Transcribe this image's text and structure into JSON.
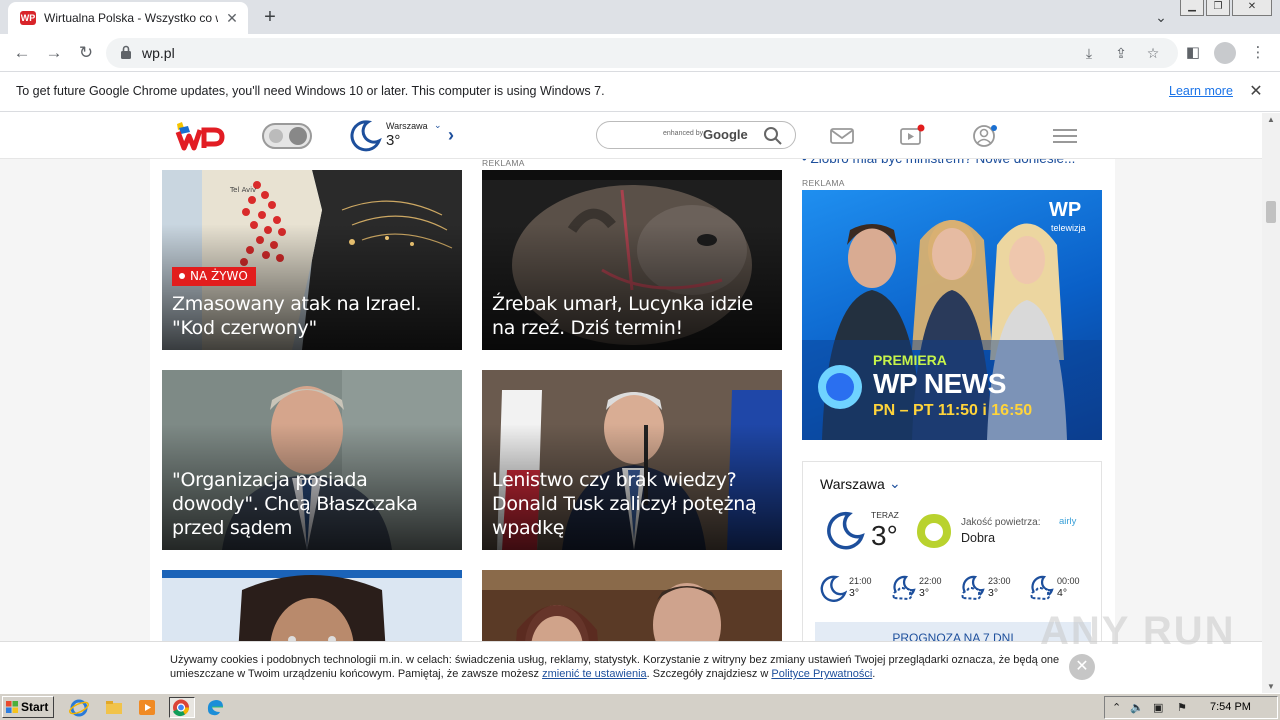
{
  "browser": {
    "tab_title": "Wirtualna Polska - Wszystko co ważne",
    "favicon_text": "WP",
    "url": "wp.pl",
    "infobar_message": "To get future Google Chrome updates, you'll need Windows 10 or later. This computer is using Windows 7.",
    "infobar_link": "Learn more"
  },
  "header": {
    "weather_city": "Warszawa",
    "weather_temp": "3°",
    "search_enhanced": "enhanced by",
    "search_brand": "Google"
  },
  "tiles": [
    {
      "headline": "Zmasowany atak na Izrael. \"Kod czerwony\"",
      "badge": "NA ŻYWO"
    },
    {
      "headline": "Źrebak umarł, Lucynka idzie na rzeź. Dziś termin!",
      "tag": "REKLAMA"
    },
    {
      "headline": "\"Organizacja posiada dowody\". Chcą Błaszczaka przed sądem"
    },
    {
      "headline": "Lenistwo czy brak wiedzy? Donald Tusk zaliczył potężną wpadkę"
    }
  ],
  "right_column": {
    "news_item": "• Ziobro miał być ministrem? Nowe doniesie...",
    "ad_tag": "REKLAMA",
    "ad_logo": "WP",
    "ad_channel": "telewizja",
    "ad_premiera": "PREMIERA",
    "ad_title": "WP NEWS",
    "ad_schedule": "PN – PT 11:50 i 16:50"
  },
  "weather": {
    "city": "Warszawa",
    "now_label": "TERAZ",
    "now_temp": "3°",
    "air_quality_label": "Jakość powietrza:",
    "air_quality_value": "Dobra",
    "air_brand": "airly",
    "hours": [
      {
        "time": "21:00",
        "temp": "3°"
      },
      {
        "time": "22:00",
        "temp": "3°"
      },
      {
        "time": "23:00",
        "temp": "3°"
      },
      {
        "time": "00:00",
        "temp": "4°"
      }
    ],
    "forecast_button": "PROGNOZA NA 7 DNI"
  },
  "cookie": {
    "text_1": "Używamy cookies i podobnych technologii m.in. w celach: świadczenia usług, reklamy, statystyk. Korzystanie z witryny bez zmiany ustawień Twojej przeglądarki oznacza, że będą one umieszczane w Twoim urządzeniu końcowym. Pamiętaj, że zawsze możesz ",
    "link_settings": "zmienić te ustawienia",
    "text_2": ". Szczegóły znajdziesz w ",
    "link_privacy": "Polityce Prywatności",
    "text_3": "."
  },
  "watermark": "ANY RUN",
  "taskbar": {
    "start_label": "Start",
    "clock": "7:54 PM"
  }
}
